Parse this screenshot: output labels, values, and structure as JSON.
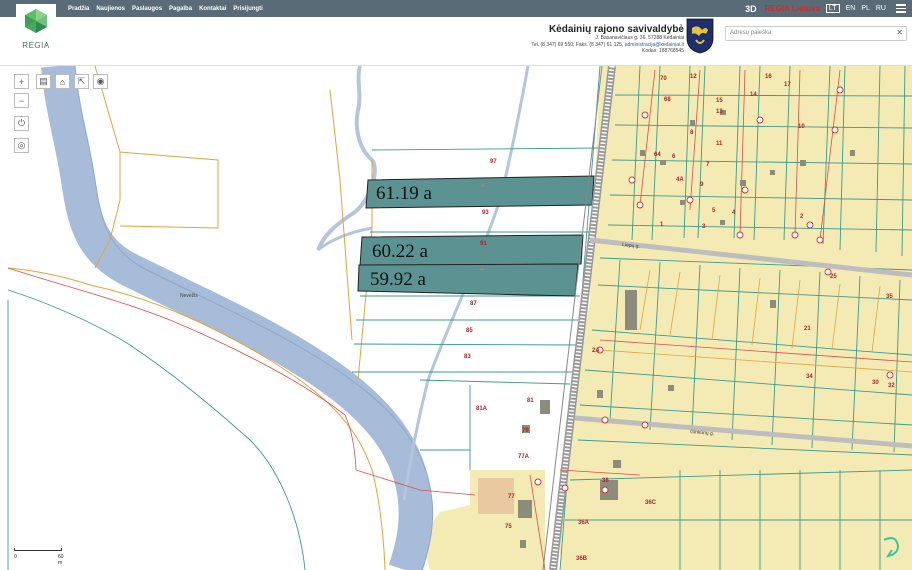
{
  "nav": [
    "Pradžia",
    "Naujienos",
    "Paslaugos",
    "Pagalba",
    "Kontaktai",
    "Prisijungti"
  ],
  "top_right": {
    "mode_3d": "3D",
    "brand": "REGIA Lietuva",
    "languages": [
      "LT",
      "EN",
      "PL",
      "RU"
    ],
    "active_language": "LT"
  },
  "logo_text": "REGIA",
  "municipality": {
    "name": "Kėdainių rajono savivaldybė",
    "address": "J. Basanavičiaus g. 36, 57288 Kėdainiai",
    "phone_fax": "Tel. (8 347) 69 550; Faks. (8 347) 61 125,",
    "email": "administracija@kedainiai.lt",
    "code": "Kodas: 188768545"
  },
  "search": {
    "placeholder": "Adresų paieška"
  },
  "map": {
    "river_label": "Nevėžis",
    "area_labels": [
      "61.19 a",
      "60.22 a",
      "59.92 a"
    ],
    "parcel_numbers_field": [
      "97",
      "93",
      "91",
      "87",
      "85",
      "83",
      "81A",
      "81",
      "79",
      "77A",
      "77",
      "75",
      "36",
      "36A",
      "36C",
      "36B"
    ],
    "street_labels": [
      "Liepų g.",
      "Ginkūnų g."
    ],
    "parcel_numbers_town": [
      "70",
      "68",
      "64",
      "4A",
      "6",
      "8",
      "12",
      "15",
      "13",
      "11",
      "9",
      "7",
      "5",
      "3",
      "1",
      "17",
      "16",
      "14",
      "10",
      "4",
      "2",
      "2A",
      "21",
      "25",
      "35",
      "32",
      "34",
      "30"
    ],
    "scale_labels": [
      "0",
      "60 m"
    ]
  },
  "colors": {
    "river": "#a6bcd9",
    "water_fill": "#a6bcd9",
    "highlight": "#5a9391",
    "parcel_line": "#3a9b8e",
    "built_area": "#f4ebb4",
    "rail": "#888888"
  }
}
